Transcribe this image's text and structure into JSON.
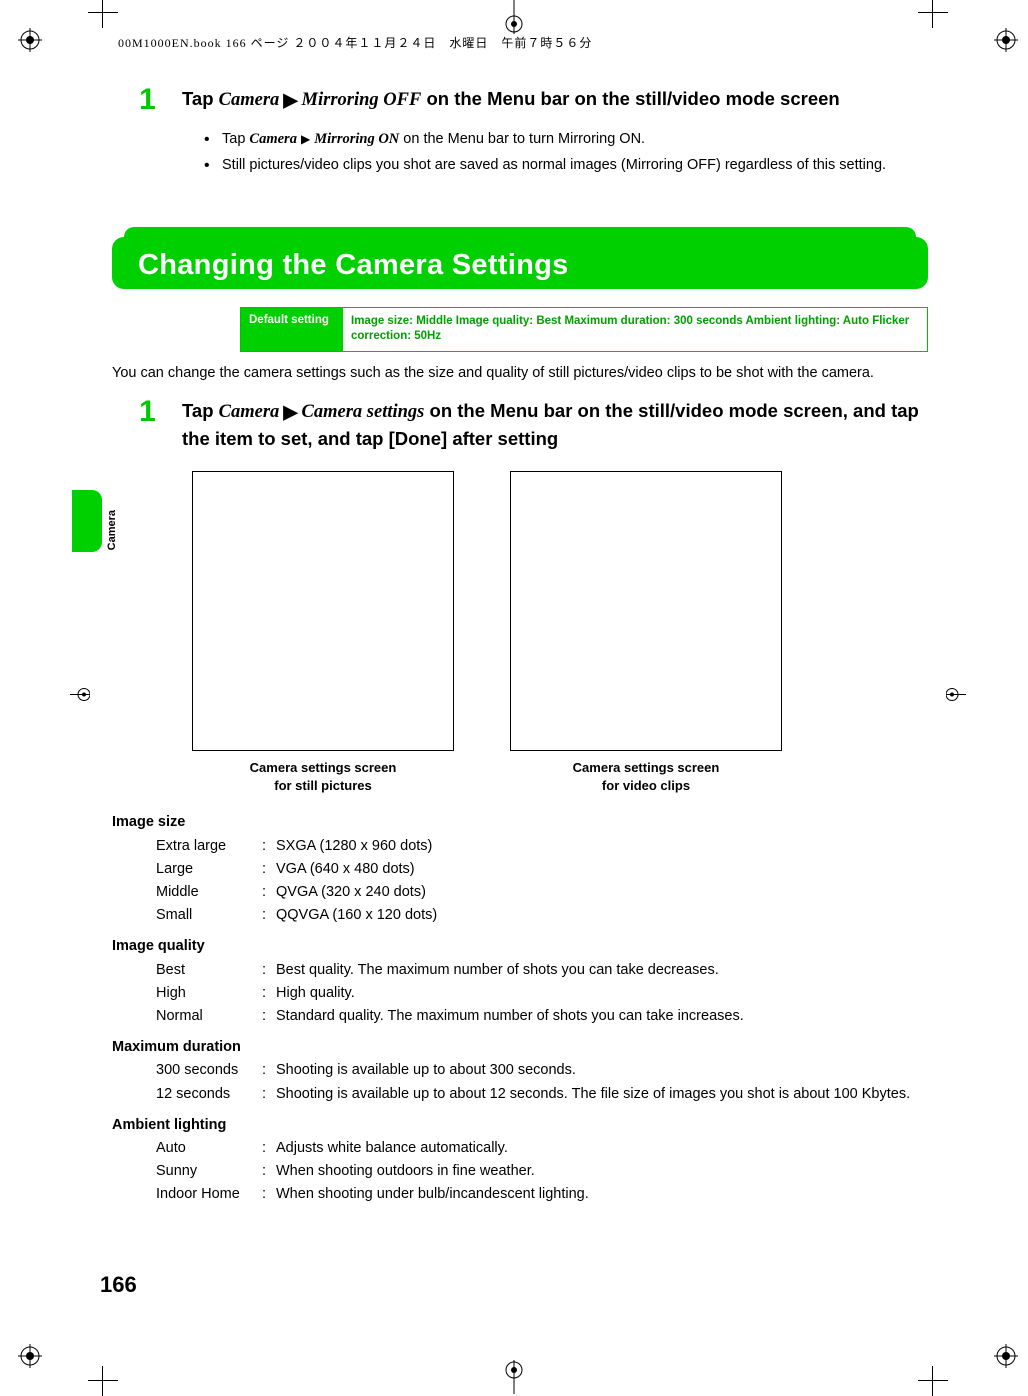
{
  "print_header": "00M1000EN.book  166 ページ  ２００４年１１月２４日　水曜日　午前７時５６分",
  "step1": {
    "num": "1",
    "prefix": "Tap ",
    "menu1": "Camera",
    "menu2": "Mirroring OFF",
    "suffix": " on the Menu bar on the still/video mode screen",
    "bullets": [
      {
        "pre": "Tap ",
        "m1": "Camera",
        "m2": "Mirroring ON",
        "post": " on the Menu bar to turn Mirroring ON."
      },
      {
        "plain": "Still pictures/video clips you shot are saved as normal images (Mirroring OFF) regardless of this setting."
      }
    ]
  },
  "section_title": "Changing the Camera Settings",
  "default_label": "Default setting",
  "default_value": "Image size: Middle Image quality: Best Maximum duration: 300 seconds Ambient lighting: Auto Flicker correction: 50Hz",
  "intro": "You can change the camera settings such as the size and quality of still pictures/video clips to be shot with the camera.",
  "step2": {
    "num": "1",
    "prefix": "Tap ",
    "menu1": "Camera",
    "menu2": "Camera settings",
    "suffix": " on the Menu bar on the still/video mode screen, and tap the item to set, and tap [Done] after setting"
  },
  "screen_caption_still_l1": "Camera settings screen",
  "screen_caption_still_l2": "for still pictures",
  "screen_caption_video_l1": "Camera settings screen",
  "screen_caption_video_l2": "for video clips",
  "settings": {
    "image_size": {
      "title": "Image size",
      "rows": [
        {
          "name": "Extra large",
          "desc": "SXGA (1280 x 960 dots)"
        },
        {
          "name": "Large",
          "desc": "VGA (640 x 480 dots)"
        },
        {
          "name": "Middle",
          "desc": "QVGA (320 x 240 dots)"
        },
        {
          "name": "Small",
          "desc": "QQVGA (160 x 120 dots)"
        }
      ]
    },
    "image_quality": {
      "title": "Image quality",
      "rows": [
        {
          "name": "Best",
          "desc": "Best quality. The maximum number of shots you can take decreases."
        },
        {
          "name": "High",
          "desc": "High quality."
        },
        {
          "name": "Normal",
          "desc": "Standard quality. The maximum number of shots you can take increases."
        }
      ]
    },
    "max_duration": {
      "title": "Maximum duration",
      "rows": [
        {
          "name": "300 seconds",
          "desc": "Shooting is available up to about 300 seconds."
        },
        {
          "name": "12 seconds",
          "desc": "Shooting is available up to about 12 seconds. The file size of images you shot is about 100 Kbytes."
        }
      ]
    },
    "ambient": {
      "title": "Ambient lighting",
      "rows": [
        {
          "name": "Auto",
          "desc": "Adjusts white balance automatically."
        },
        {
          "name": "Sunny",
          "desc": "When shooting outdoors in fine weather."
        },
        {
          "name": "Indoor Home",
          "desc": "When shooting under bulb/incandescent lighting."
        }
      ]
    }
  },
  "side_tab_label": "Camera",
  "page_number": "166"
}
